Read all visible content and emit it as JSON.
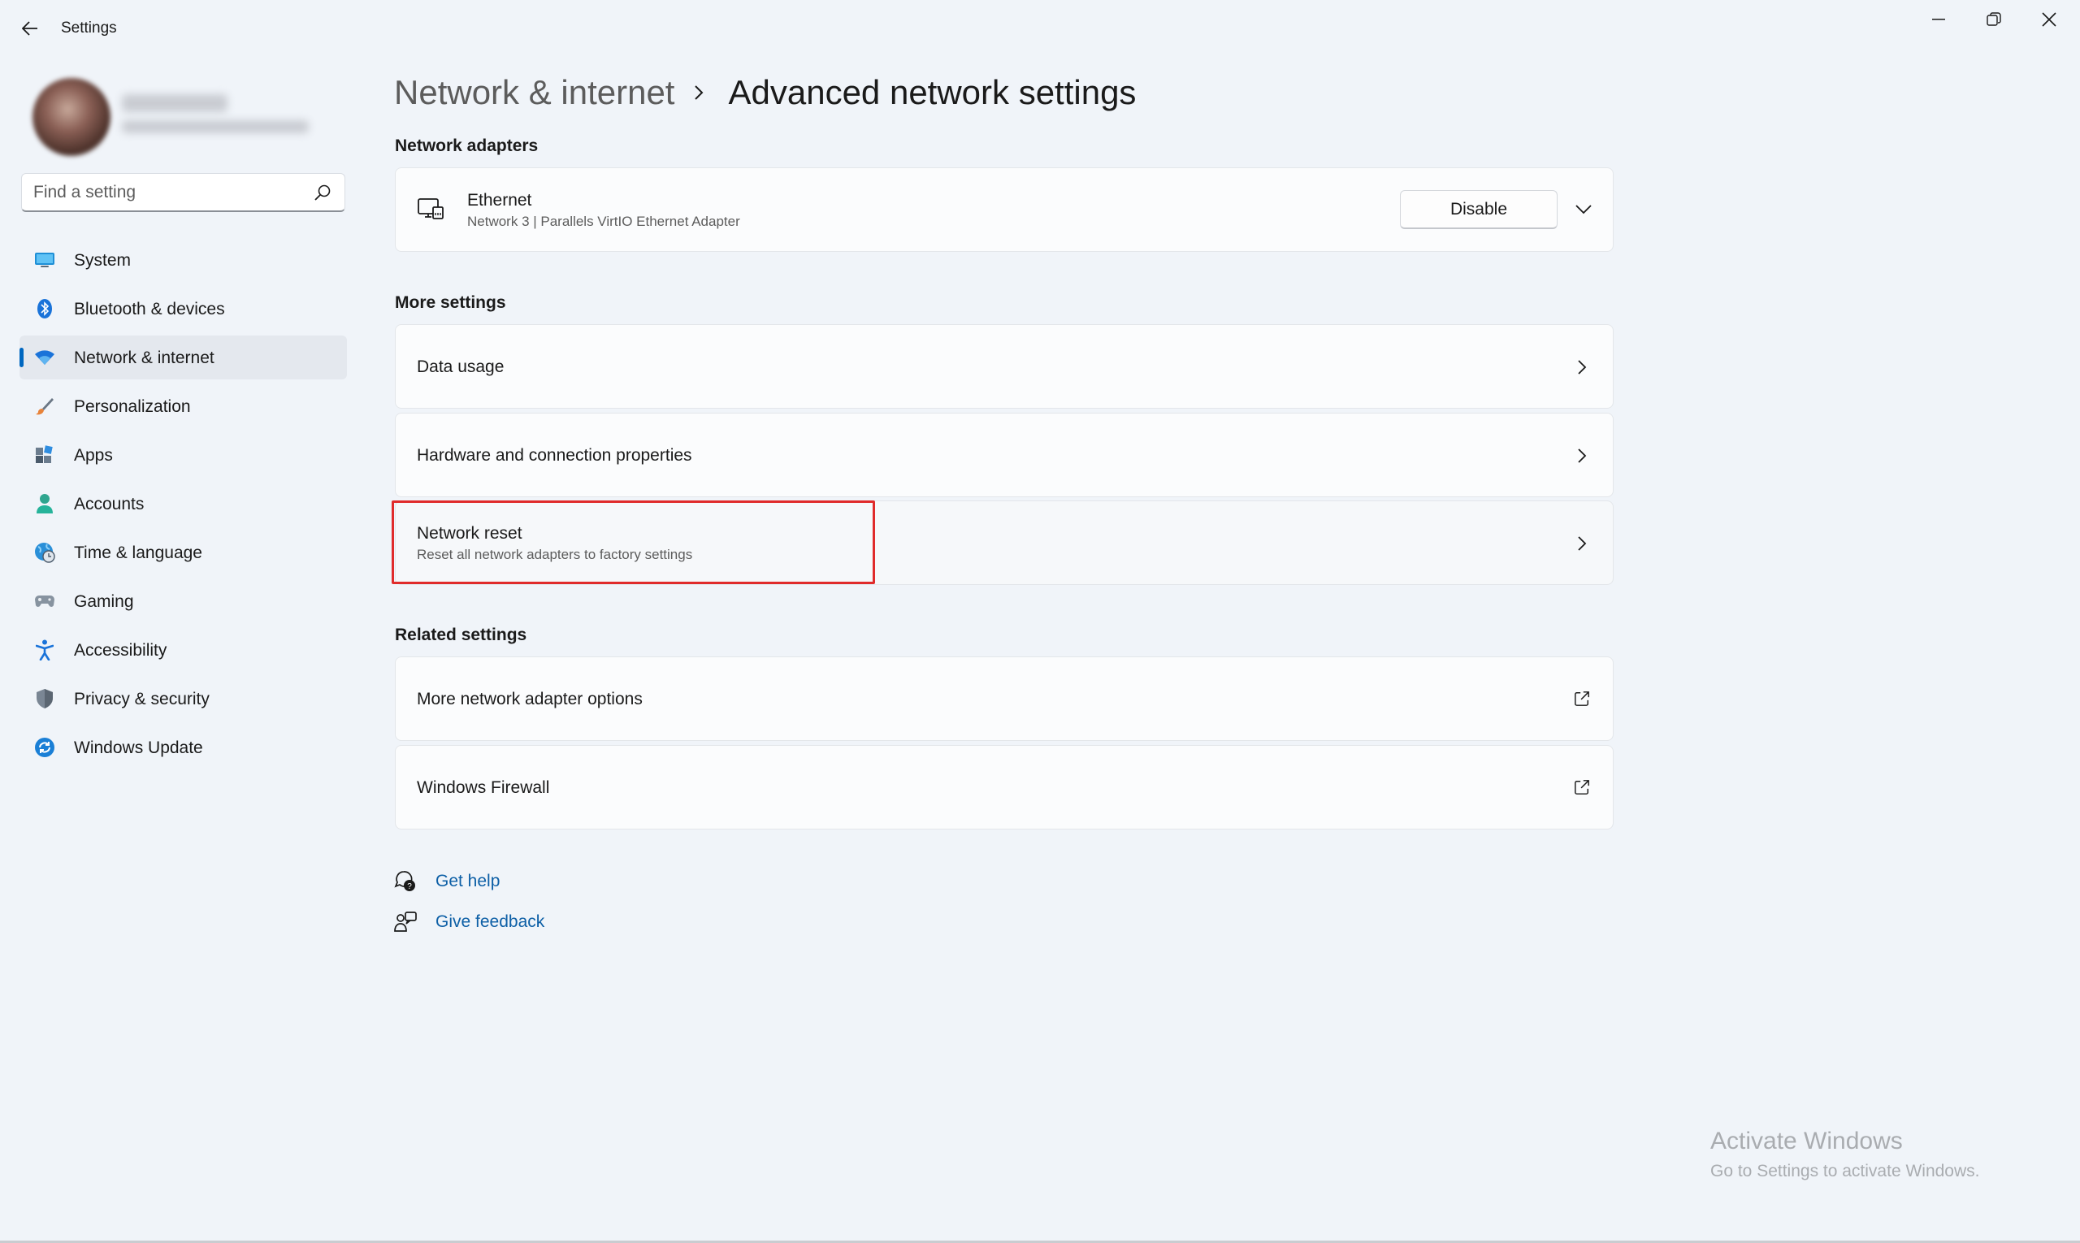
{
  "window": {
    "title": "Settings",
    "controls": [
      "minimize",
      "restore",
      "close"
    ]
  },
  "sidebar": {
    "search": {
      "placeholder": "Find a setting",
      "value": ""
    },
    "items": [
      {
        "label": "System",
        "icon": "monitor-icon",
        "active": false
      },
      {
        "label": "Bluetooth & devices",
        "icon": "bluetooth-icon",
        "active": false
      },
      {
        "label": "Network & internet",
        "icon": "wifi-icon",
        "active": true
      },
      {
        "label": "Personalization",
        "icon": "brush-icon",
        "active": false
      },
      {
        "label": "Apps",
        "icon": "apps-icon",
        "active": false
      },
      {
        "label": "Accounts",
        "icon": "person-icon",
        "active": false
      },
      {
        "label": "Time & language",
        "icon": "globe-clock-icon",
        "active": false
      },
      {
        "label": "Gaming",
        "icon": "gamepad-icon",
        "active": false
      },
      {
        "label": "Accessibility",
        "icon": "accessibility-icon",
        "active": false
      },
      {
        "label": "Privacy & security",
        "icon": "shield-icon",
        "active": false
      },
      {
        "label": "Windows Update",
        "icon": "update-icon",
        "active": false
      }
    ]
  },
  "breadcrumb": {
    "parent": "Network & internet",
    "current": "Advanced network settings"
  },
  "network_adapters": {
    "title": "Network adapters",
    "adapter": {
      "name": "Ethernet",
      "description": "Network 3 | Parallels VirtIO Ethernet Adapter",
      "button": "Disable"
    }
  },
  "more_settings": {
    "title": "More settings",
    "items": [
      {
        "label": "Data usage"
      },
      {
        "label": "Hardware and connection properties"
      },
      {
        "label": "Network reset",
        "sub": "Reset all network adapters to factory settings"
      }
    ]
  },
  "related_settings": {
    "title": "Related settings",
    "items": [
      {
        "label": "More network adapter options"
      },
      {
        "label": "Windows Firewall"
      }
    ]
  },
  "help": {
    "get_help": "Get help",
    "give_feedback": "Give feedback"
  },
  "watermark": {
    "title": "Activate Windows",
    "sub": "Go to Settings to activate Windows."
  },
  "colors": {
    "accent": "#0067c0",
    "highlight": "#e02b2b",
    "link": "#0d5fa6",
    "background": "#f0f4f9"
  }
}
